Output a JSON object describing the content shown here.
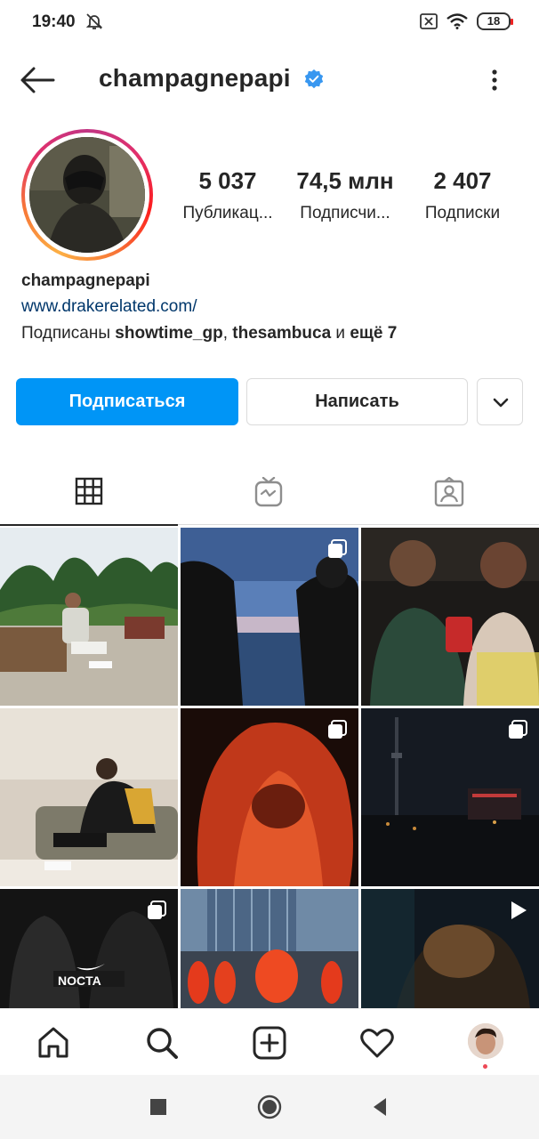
{
  "status_bar": {
    "time": "19:40",
    "battery": "18",
    "icons": [
      "alarm-off-icon",
      "sim-off-icon",
      "wifi-icon",
      "battery-icon"
    ]
  },
  "header": {
    "username": "champagnepapi",
    "icons": [
      "back-arrow-icon",
      "verified-badge-icon",
      "more-vertical-icon"
    ]
  },
  "profile": {
    "stats": [
      {
        "value": "5 037",
        "label": "Публикац..."
      },
      {
        "value": "74,5 млн",
        "label": "Подписчи..."
      },
      {
        "value": "2 407",
        "label": "Подписки"
      }
    ],
    "name": "champagnepapi",
    "link": "www.drakerelated.com/",
    "followed_by": {
      "prefix": "Подписаны ",
      "user1": "showtime_gp",
      "sep": ", ",
      "user2": "thesambuca",
      "middle": " и ",
      "more": "ещё 7"
    }
  },
  "actions": {
    "follow": "Подписаться",
    "message": "Написать"
  },
  "tabs": [
    "grid-icon",
    "igtv-icon",
    "tagged-icon"
  ],
  "grid_posts": [
    {
      "type": "photo"
    },
    {
      "type": "carousel"
    },
    {
      "type": "photo"
    },
    {
      "type": "photo"
    },
    {
      "type": "carousel"
    },
    {
      "type": "carousel"
    },
    {
      "type": "carousel"
    },
    {
      "type": "photo"
    },
    {
      "type": "video"
    }
  ],
  "bottom_nav": [
    "home-icon",
    "search-icon",
    "new-post-icon",
    "activity-heart-icon",
    "profile-avatar"
  ],
  "colors": {
    "accent": "#0095f6",
    "text": "#262626",
    "link": "#00376b",
    "border": "#dbdbdb",
    "notification": "#ed4956"
  }
}
